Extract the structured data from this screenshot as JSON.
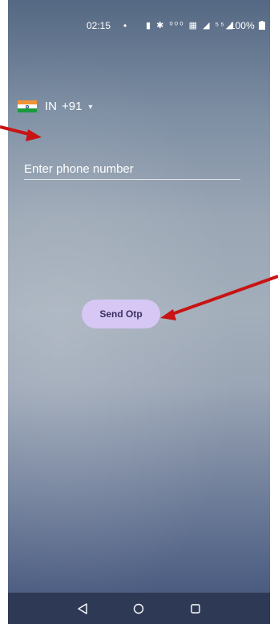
{
  "status_bar": {
    "time": "02:15",
    "dot": "•",
    "icons_text": "▮ ✱ ⁰⁰⁰ ▦ ◢ ⁵⁵◢",
    "battery": "100%"
  },
  "country_picker": {
    "country": "IN",
    "code": "+91"
  },
  "phone_input": {
    "placeholder": "Enter phone number",
    "value": ""
  },
  "send_button": {
    "label": "Send Otp"
  },
  "colors": {
    "button_bg": "#d6c7f4",
    "annotation_arrow": "#c81414"
  },
  "icons": {
    "flag": "india-flag-icon",
    "dropdown": "dropdown-arrow-icon",
    "back": "back-triangle-icon",
    "home": "home-circle-icon",
    "recents": "recents-square-icon"
  }
}
